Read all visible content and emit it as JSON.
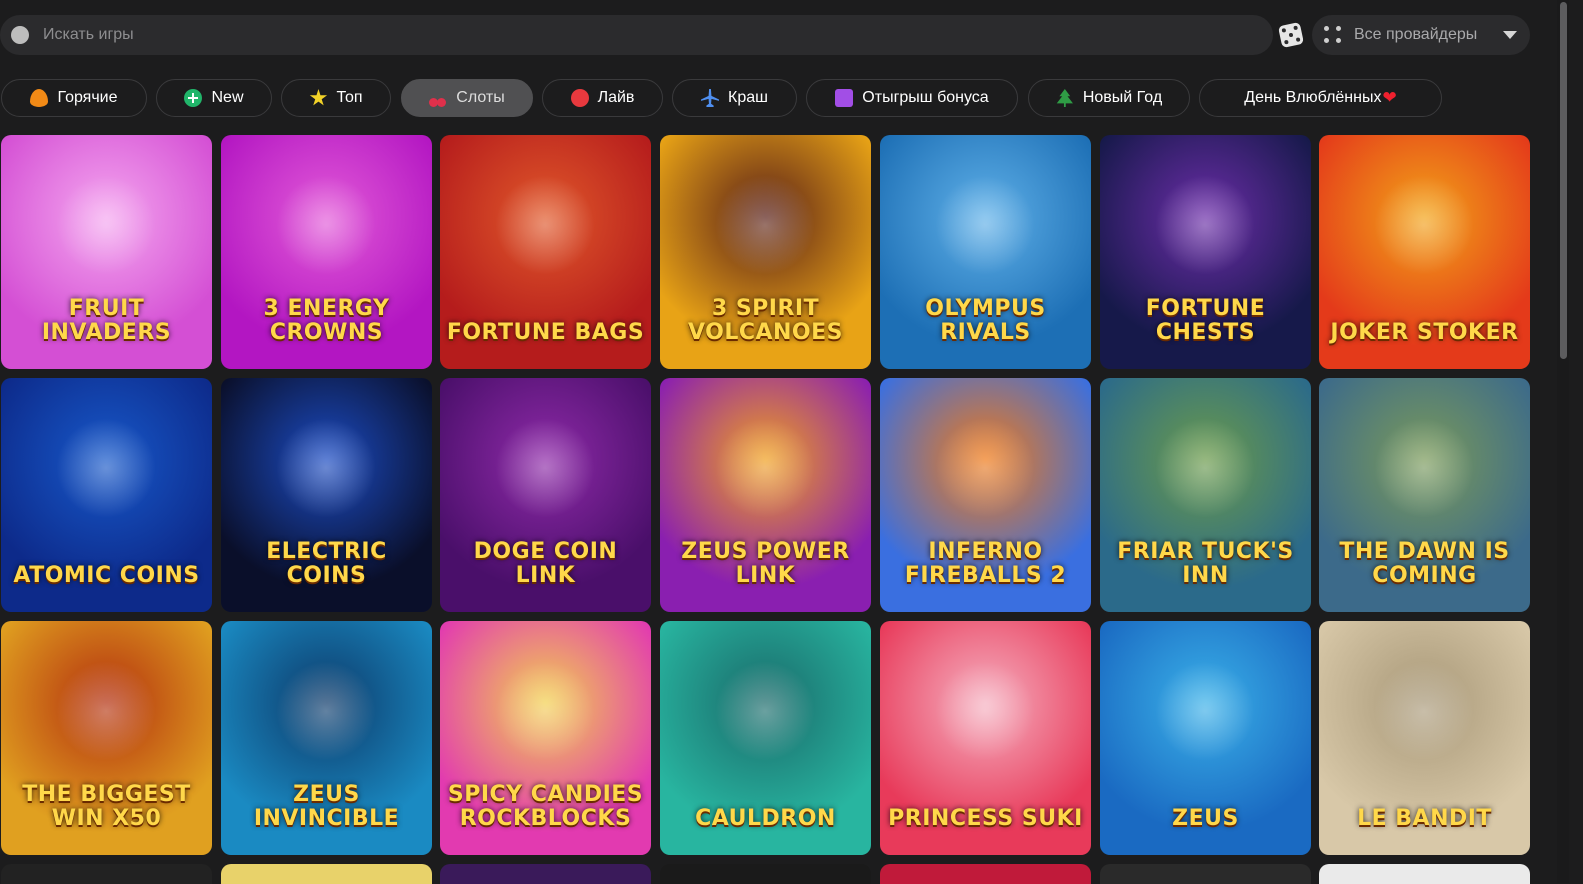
{
  "search": {
    "placeholder": "Искать игры"
  },
  "provider_select": {
    "selected": "Все провайдеры"
  },
  "categories": [
    {
      "label": "Горячие",
      "icon": "fire-icon"
    },
    {
      "label": "New",
      "icon": "plus-circle-icon"
    },
    {
      "label": "Топ",
      "icon": "star-icon"
    },
    {
      "label": "Слоты",
      "icon": "cherry-icon",
      "active": true
    },
    {
      "label": "Лайв",
      "icon": "chip-icon"
    },
    {
      "label": "Краш",
      "icon": "airplane-icon"
    },
    {
      "label": "Отыгрыш бонуса",
      "icon": "gift-icon"
    },
    {
      "label": "Новый Год",
      "icon": "tree-icon"
    },
    {
      "label": "День Влюблённых",
      "icon": "heart-icon"
    }
  ],
  "heart_glyph": "❤",
  "games": [
    {
      "title": "Fruit Invaders",
      "bg": "#d44fd4",
      "bg2": "#f4a6ef"
    },
    {
      "title": "3 Energy Crowns",
      "bg": "#b316c2",
      "bg2": "#e25ad8"
    },
    {
      "title": "Fortune Bags",
      "bg": "#b51c1c",
      "bg2": "#e0582a"
    },
    {
      "title": "3 Spirit Volcanoes",
      "bg": "#e8a316",
      "bg2": "#5a2018"
    },
    {
      "title": "Olympus Rivals",
      "bg": "#1d6fb5",
      "bg2": "#5fb0e8"
    },
    {
      "title": "Fortune Chests",
      "bg": "#16194a",
      "bg2": "#6b2da8"
    },
    {
      "title": "Joker Stoker",
      "bg": "#e43a1a",
      "bg2": "#f2a318"
    },
    {
      "title": "Atomic Coins",
      "bg": "#0d2a8a",
      "bg2": "#1758c9"
    },
    {
      "title": "Electric Coins",
      "bg": "#0a0f2a",
      "bg2": "#1b4bc2"
    },
    {
      "title": "Doge Coin Link",
      "bg": "#4a0f6a",
      "bg2": "#8e2aa8"
    },
    {
      "title": "Zeus Power Link",
      "bg": "#8a1fb0",
      "bg2": "#f0a020"
    },
    {
      "title": "Inferno Fireballs 2",
      "bg": "#3a6fe0",
      "bg2": "#f07a18"
    },
    {
      "title": "Friar Tuck's Inn",
      "bg": "#2b6a8a",
      "bg2": "#6a9a4a"
    },
    {
      "title": "The Dawn is Coming",
      "bg": "#3c6a8a",
      "bg2": "#7a9a5a"
    },
    {
      "title": "The Biggest Win x50",
      "bg": "#e0a020",
      "bg2": "#b3300f"
    },
    {
      "title": "Zeus Invincible",
      "bg": "#1a8ac2",
      "bg2": "#0d3a6a"
    },
    {
      "title": "Spicy Candies Rockblocks",
      "bg": "#e23ab0",
      "bg2": "#f2d050"
    },
    {
      "title": "Cauldron",
      "bg": "#28b5a0",
      "bg2": "#1a6a6a"
    },
    {
      "title": "Princess Suki",
      "bg": "#e83a5a",
      "bg2": "#f5b0c0"
    },
    {
      "title": "Zeus",
      "bg": "#1a6ac2",
      "bg2": "#3ab0e8"
    },
    {
      "title": "Le Bandit",
      "bg": "#d8c8a8",
      "bg2": "#a89878"
    }
  ],
  "partial_row_colors": [
    "#222",
    "#e8d26a",
    "#3a1a5a",
    "#1a1a1a",
    "#c01a3a",
    "#2a2a2a",
    "#eaeaea"
  ]
}
